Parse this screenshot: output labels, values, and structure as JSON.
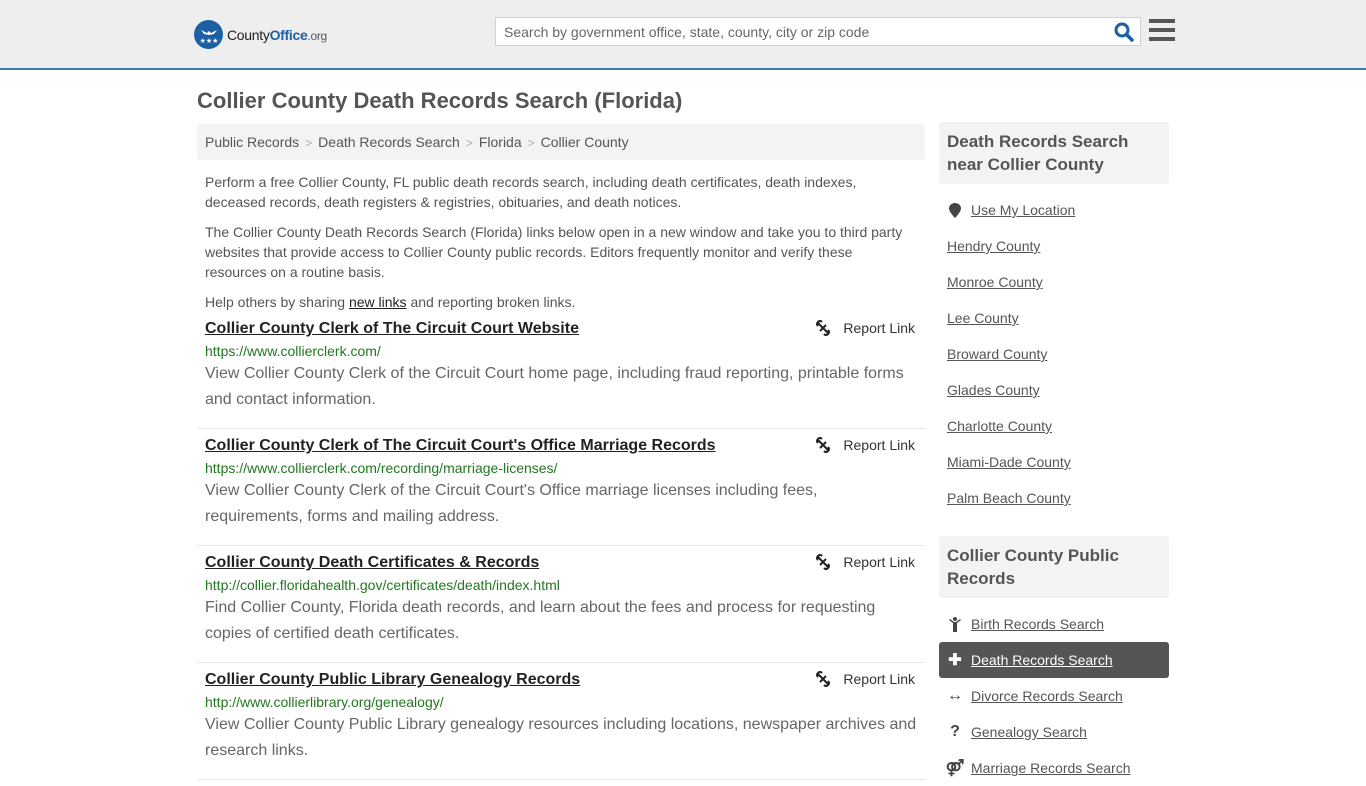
{
  "header": {
    "logo": {
      "name": "County",
      "accent": "Office",
      "tld": ".org"
    },
    "search": {
      "placeholder": "Search by government office, state, county, city or zip code",
      "value": ""
    },
    "accent_color": "#3a7aad",
    "brand_color": "#1d5fa3"
  },
  "page": {
    "title": "Collier County Death Records Search (Florida)"
  },
  "breadcrumb": [
    {
      "label": "Public Records"
    },
    {
      "label": "Death Records Search"
    },
    {
      "label": "Florida"
    },
    {
      "label": "Collier County"
    }
  ],
  "intro": {
    "p1": "Perform a free Collier County, FL public death records search, including death certificates, death indexes, deceased records, death registers & registries, obituaries, and death notices.",
    "p2": "The Collier County Death Records Search (Florida) links below open in a new window and take you to third party websites that provide access to Collier County public records. Editors frequently monitor and verify these resources on a routine basis.",
    "p3_before": "Help others by sharing ",
    "p3_link": "new links",
    "p3_after": " and reporting broken links."
  },
  "results": [
    {
      "title": "Collier County Clerk of The Circuit Court Website",
      "url": "https://www.collierclerk.com/",
      "description": "View Collier County Clerk of the Circuit Court home page, including fraud reporting, printable forms and contact information.",
      "report_label": "Report Link"
    },
    {
      "title": "Collier County Clerk of The Circuit Court's Office Marriage Records",
      "url": "https://www.collierclerk.com/recording/marriage-licenses/",
      "description": "View Collier County Clerk of the Circuit Court's Office marriage licenses including fees, requirements, forms and mailing address.",
      "report_label": "Report Link"
    },
    {
      "title": "Collier County Death Certificates & Records",
      "url": "http://collier.floridahealth.gov/certificates/death/index.html",
      "description": "Find Collier County, Florida death records, and learn about the fees and process for requesting copies of certified death certificates.",
      "report_label": "Report Link"
    },
    {
      "title": "Collier County Public Library Genealogy Records",
      "url": "http://www.collierlibrary.org/genealogy/",
      "description": "View Collier County Public Library genealogy resources including locations, newspaper archives and research links.",
      "report_label": "Report Link"
    }
  ],
  "sidebar": {
    "nearby": {
      "heading": "Death Records Search near Collier County",
      "use_location": "Use My Location",
      "items": [
        "Hendry County",
        "Monroe County",
        "Lee County",
        "Broward County",
        "Glades County",
        "Charlotte County",
        "Miami-Dade County",
        "Palm Beach County"
      ]
    },
    "public_records": {
      "heading": "Collier County Public Records",
      "items": [
        {
          "label": "Birth Records Search",
          "icon": "child-icon",
          "active": false
        },
        {
          "label": "Death Records Search",
          "icon": "plus-icon",
          "active": true
        },
        {
          "label": "Divorce Records Search",
          "icon": "arrows-horizontal-icon",
          "active": false
        },
        {
          "label": "Genealogy Search",
          "icon": "question-icon",
          "active": false
        },
        {
          "label": "Marriage Records Search",
          "icon": "venus-mars-icon",
          "active": false
        }
      ]
    }
  }
}
